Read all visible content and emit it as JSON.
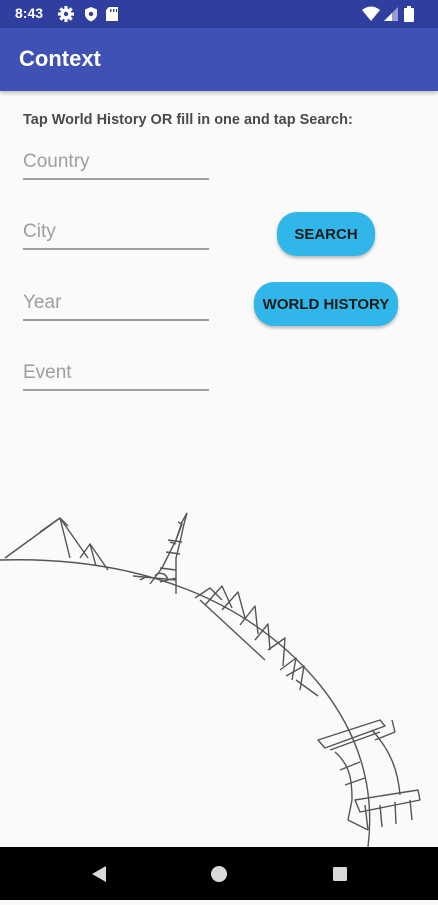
{
  "status_bar": {
    "time": "8:43",
    "icons_left": [
      "gear-icon",
      "shield-icon",
      "sd-card-icon"
    ],
    "icons_right": [
      "wifi-icon",
      "signal-icon",
      "battery-icon"
    ]
  },
  "app_bar": {
    "title": "Context"
  },
  "form": {
    "instruction": "Tap World History OR fill in one and tap Search:",
    "country_placeholder": "Country",
    "city_placeholder": "City",
    "year_placeholder": "Year",
    "event_placeholder": "Event",
    "search_label": "SEARCH",
    "world_history_label": "WORLD HISTORY"
  },
  "colors": {
    "app_bar": "#3f51b5",
    "status_bar": "#303f9f",
    "button": "#30b6e8"
  },
  "illustration": {
    "subject": "globe-landmarks"
  },
  "nav_bar": {
    "icons": [
      "back-icon",
      "home-icon",
      "recents-icon"
    ]
  }
}
